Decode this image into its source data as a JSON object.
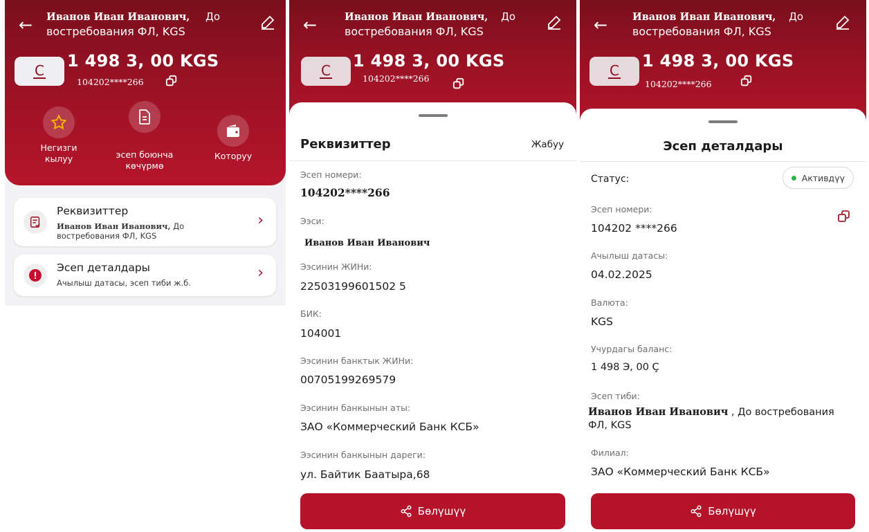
{
  "accent_color": "#b4132a",
  "account_header": {
    "holder_name": "Иванов Иван Иванович,",
    "suffix_inline": "До",
    "suffix_line2": "востребования ФЛ, KGS",
    "card_logo_letter": "C",
    "balance": "1 498 3, 00 KGS",
    "masked_number": "104202****266"
  },
  "screen1": {
    "actions": [
      {
        "label_line1": "Негизги",
        "label_line2": "кылуу",
        "icon": "star-icon"
      },
      {
        "label_line1": "эсеп боюнча",
        "label_line2": "көчүрмө",
        "icon": "document-icon"
      },
      {
        "label_line1": "Которуу",
        "label_line2": "",
        "icon": "wallet-icon"
      }
    ],
    "menu": [
      {
        "title": "Реквизиттер",
        "subtitle_bold": "Иванов Иван Иванович,",
        "subtitle_rest": " До",
        "subtitle_line2": "востребования ФЛ, KGS",
        "icon": "requisites-icon"
      },
      {
        "title": "Эсеп деталдары",
        "subtitle_bold": "",
        "subtitle_rest": "Ачылыш датасы, эсеп тиби ж.б.",
        "subtitle_line2": "",
        "icon": "alert-icon"
      }
    ]
  },
  "screen2": {
    "title": "Реквизиттер",
    "close_label": "Жабуу",
    "fields": [
      {
        "label": "Эсеп номери:",
        "value": "104202****266"
      },
      {
        "label": "Ээси:",
        "value": "Иванов Иван Иванович"
      },
      {
        "label": "Ээсинин ЖИНи:",
        "value": "22503199601502 5"
      },
      {
        "label": "БИК:",
        "value": "104001"
      },
      {
        "label": "Ээсинин банктык ЖИНи:",
        "value": "00705199269579"
      },
      {
        "label": "Ээсинин банкынын аты:",
        "value": "ЗАО «Коммерческий Банк КСБ»"
      },
      {
        "label": "Ээсинин банкынын дареги:",
        "value": "ул. Байтик Баатыра,68"
      }
    ],
    "share_label": "Бөлүшүү"
  },
  "screen3": {
    "title": "Эсеп деталдары",
    "status_label": "Статус:",
    "status_value": "Активдүү",
    "status_color": "#2eb24a",
    "fields": [
      {
        "label": "Эсеп номери:",
        "value": "104202  ****266"
      },
      {
        "label": "Ачылыш датасы:",
        "value": "04.02.2025"
      },
      {
        "label": "Валюта:",
        "value": "KGS"
      },
      {
        "label": "Учурдагы баланс:",
        "value": "1 498 Э, 00 Ç"
      },
      {
        "label": "Эсеп тиби:",
        "value_bold": "Иванов Иван Иванович",
        "value_rest": " , До востребования",
        "value_line2": "ФЛ, KGS"
      },
      {
        "label": "Филиал:",
        "value": "ЗАО «Коммерческий Банк КСБ»"
      }
    ],
    "share_label": "Бөлүшүү"
  }
}
